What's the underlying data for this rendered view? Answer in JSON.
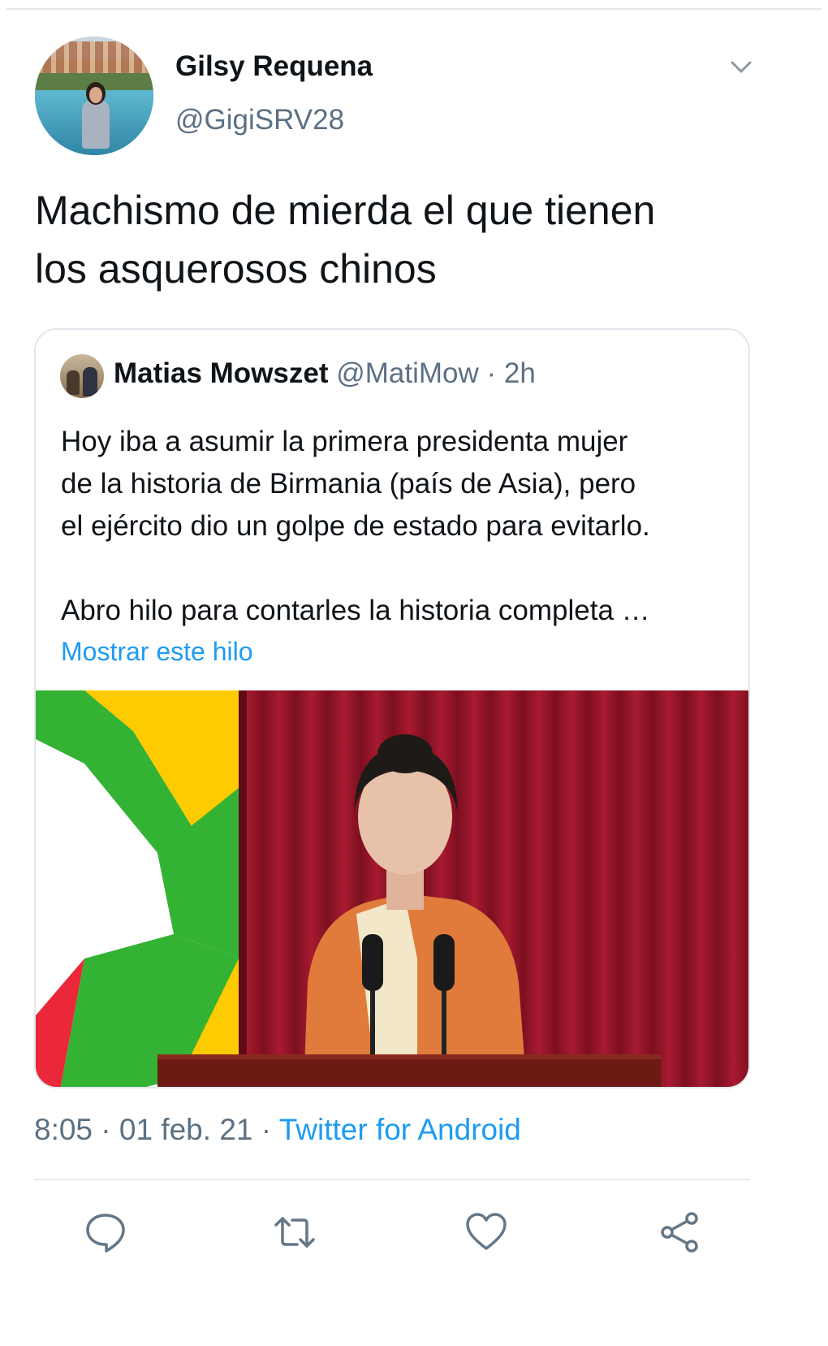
{
  "author": {
    "display_name": "Gilsy Requena",
    "handle": "@GigiSRV28"
  },
  "tweet": {
    "text": "Machismo de mierda el que tienen los asqueros­sos chinos",
    "lines": [
      "Machismo de mierda el que tienen",
      "los asquerosos chinos"
    ]
  },
  "quoted": {
    "name": "Matias Mowszet",
    "handle_time": "@MatiMow · 2h",
    "body_lines": [
      "Hoy iba a asumir la primera presidenta mujer",
      "de la historia de Birmania (país de Asia), pero",
      "el ejército dio un golpe de estado para evitarlo.",
      "Abro hilo para contarles la historia completa …"
    ],
    "show_thread": "Mostrar este hilo"
  },
  "meta": {
    "time_date": "8:05 · 01 feb. 21 · ",
    "source": "Twitter for Android"
  },
  "icons": {
    "chevron": "chevron-down-icon",
    "reply": "reply-icon",
    "retweet": "retweet-icon",
    "like": "heart-icon",
    "share": "share-icon"
  },
  "colors": {
    "link": "#1d9bf0",
    "secondary_text": "#5b7083",
    "curtain": "#8e1426",
    "flag_yellow": "#fecb00",
    "flag_green": "#34b233",
    "flag_red": "#ea2839"
  }
}
